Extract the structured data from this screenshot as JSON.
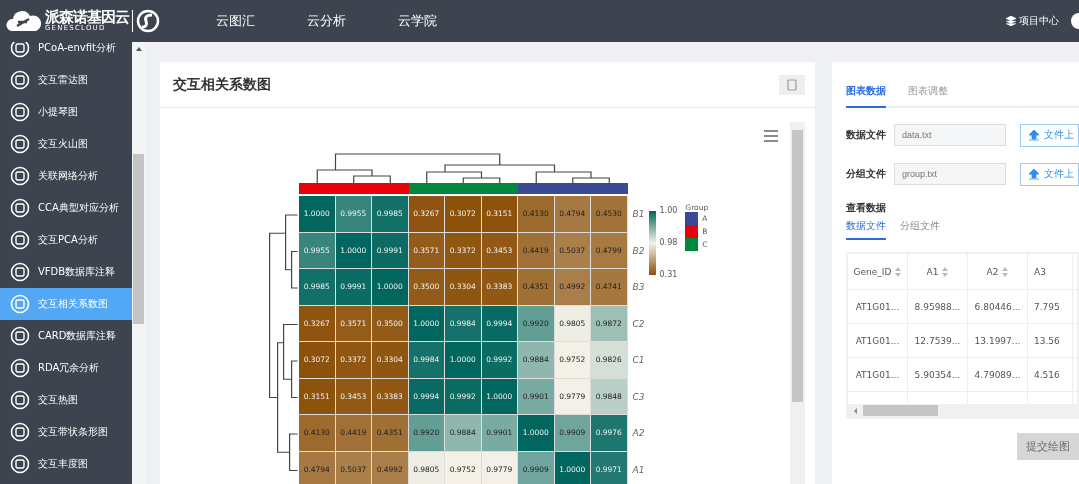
{
  "header": {
    "logo_text": "派森诺基因云",
    "logo_subtext": "GENESCLOUD",
    "nav": [
      {
        "label": "云图汇"
      },
      {
        "label": "云分析"
      },
      {
        "label": "云学院"
      }
    ],
    "project_center": "项目中心"
  },
  "sidebar": {
    "items": [
      {
        "label": "PCoA-envfit分析",
        "selected": false
      },
      {
        "label": "交互雷达图",
        "selected": false
      },
      {
        "label": "小提琴图",
        "selected": false
      },
      {
        "label": "交互火山图",
        "selected": false
      },
      {
        "label": "关联网络分析",
        "selected": false
      },
      {
        "label": "CCA典型对应分析",
        "selected": false
      },
      {
        "label": "交互PCA分析",
        "selected": false
      },
      {
        "label": "VFDB数据库注释",
        "selected": false
      },
      {
        "label": "交互相关系数图",
        "selected": true
      },
      {
        "label": "CARD数据库注释",
        "selected": false
      },
      {
        "label": "RDA冗余分析",
        "selected": false
      },
      {
        "label": "交互热图",
        "selected": false
      },
      {
        "label": "交互带状条形图",
        "selected": false
      },
      {
        "label": "交互丰度图",
        "selected": false
      }
    ]
  },
  "card": {
    "title": "交互相关系数图",
    "heatmap": {
      "column_groups": [
        {
          "color": "#e8000b"
        },
        {
          "color": "#00883e"
        },
        {
          "color": "#3b4a96"
        }
      ],
      "row_labels": [
        "B1",
        "B2",
        "B3",
        "C2",
        "C1",
        "C3",
        "A2",
        "A1"
      ],
      "rows": [
        [
          "1.0000",
          "0.9955",
          "0.9985",
          "0.3267",
          "0.3072",
          "0.3151",
          "0.4130",
          "0.4794",
          "0.4530"
        ],
        [
          "0.9955",
          "1.0000",
          "0.9991",
          "0.3571",
          "0.3372",
          "0.3453",
          "0.4419",
          "0.5037",
          "0.4799"
        ],
        [
          "0.9985",
          "0.9991",
          "1.0000",
          "0.3500",
          "0.3304",
          "0.3383",
          "0.4351",
          "0.4992",
          "0.4741"
        ],
        [
          "0.3267",
          "0.3571",
          "0.3500",
          "1.0000",
          "0.9984",
          "0.9994",
          "0.9920",
          "0.9805",
          "0.9872"
        ],
        [
          "0.3072",
          "0.3372",
          "0.3304",
          "0.9984",
          "1.0000",
          "0.9992",
          "0.9884",
          "0.9752",
          "0.9826"
        ],
        [
          "0.3151",
          "0.3453",
          "0.3383",
          "0.9994",
          "0.9992",
          "1.0000",
          "0.9901",
          "0.9779",
          "0.9848"
        ],
        [
          "0.4130",
          "0.4419",
          "0.4351",
          "0.9920",
          "0.9884",
          "0.9901",
          "1.0000",
          "0.9909",
          "0.9976"
        ],
        [
          "0.4794",
          "0.5037",
          "0.4992",
          "0.9805",
          "0.9752",
          "0.9779",
          "0.9909",
          "1.0000",
          "0.9971"
        ]
      ],
      "legend": {
        "colorbar_labels": [
          "1.00",
          "0.98",
          "0.31"
        ],
        "group_title": "Group",
        "groups": [
          {
            "label": "A",
            "color": "#3b4a96"
          },
          {
            "label": "B",
            "color": "#e8000b"
          },
          {
            "label": "C",
            "color": "#00883e"
          }
        ]
      }
    }
  },
  "panel": {
    "tabs": [
      {
        "label": "图表数据",
        "selected": true
      },
      {
        "label": "图表调整",
        "selected": false
      }
    ],
    "fields": [
      {
        "label": "数据文件",
        "placeholder": "data.txt",
        "button": "文件上"
      },
      {
        "label": "分组文件",
        "placeholder": "group.txt",
        "button": "文件上"
      }
    ],
    "view_title": "查看数据",
    "subtabs": [
      {
        "label": "数据文件",
        "selected": true
      },
      {
        "label": "分组文件",
        "selected": false
      }
    ],
    "table": {
      "columns": [
        {
          "label": "Gene_ID",
          "sortable": true
        },
        {
          "label": "A1",
          "sortable": true
        },
        {
          "label": "A2",
          "sortable": true
        },
        {
          "label": "A3",
          "sortable": false
        }
      ],
      "rows": [
        [
          "AT1G01...",
          "8.95988...",
          "6.80446...",
          "7.795"
        ],
        [
          "AT1G01...",
          "12.7539...",
          "13.1997...",
          "13.56"
        ],
        [
          "AT1G01...",
          "5.90354...",
          "4.79089...",
          "4.516"
        ]
      ]
    },
    "submit": {
      "label": "提交绘图",
      "disabled": true
    }
  }
}
